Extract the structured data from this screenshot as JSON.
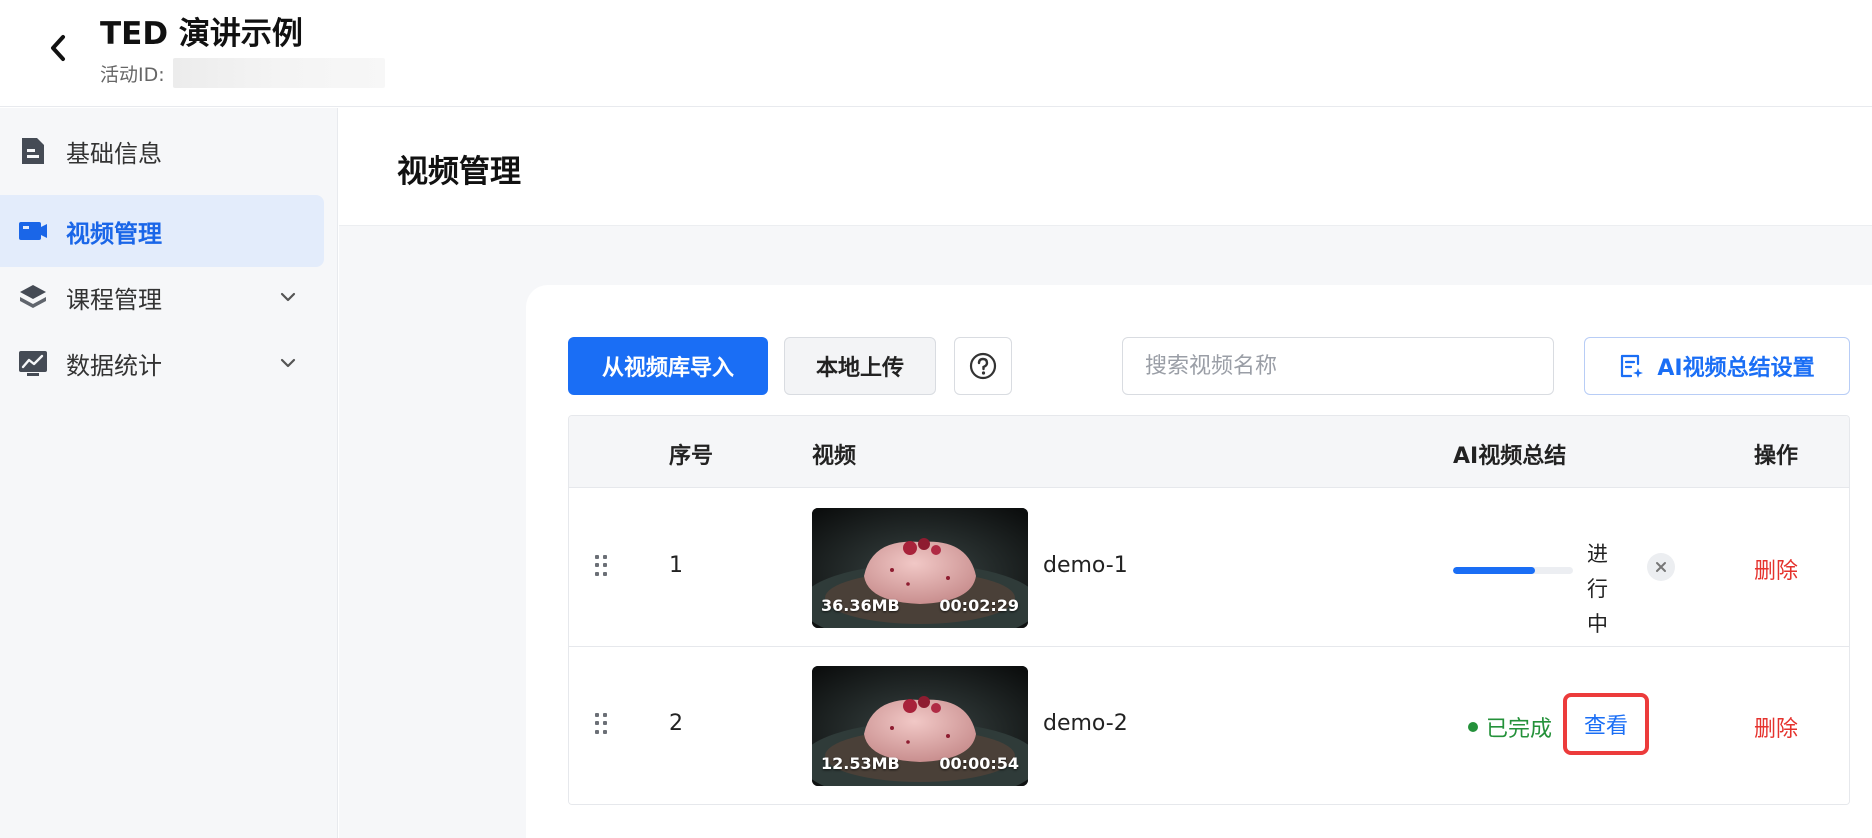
{
  "header": {
    "title": "TED 演讲示例",
    "activity_id_label": "活动ID:"
  },
  "sidebar": {
    "items": [
      {
        "label": "基础信息",
        "icon": "document-icon",
        "active": false
      },
      {
        "label": "视频管理",
        "icon": "video-icon",
        "active": true
      },
      {
        "label": "课程管理",
        "icon": "layers-icon",
        "active": false,
        "expandable": true
      },
      {
        "label": "数据统计",
        "icon": "chart-icon",
        "active": false,
        "expandable": true
      }
    ]
  },
  "main": {
    "page_title": "视频管理",
    "toolbar": {
      "import_label": "从视频库导入",
      "upload_label": "本地上传",
      "help_icon": "question-icon",
      "search_placeholder": "搜索视频名称",
      "ai_settings_label": "AI视频总结设置"
    },
    "table": {
      "columns": [
        "序号",
        "视频",
        "AI视频总结",
        "操作"
      ],
      "rows": [
        {
          "seq": "1",
          "name": "demo-1",
          "size": "36.36MB",
          "duration": "00:02:29",
          "ai_status": "in_progress",
          "progress": 0.68,
          "progress_text": "进行中",
          "action": "删除"
        },
        {
          "seq": "2",
          "name": "demo-2",
          "size": "12.53MB",
          "duration": "00:00:54",
          "ai_status": "done",
          "status_text": "已完成",
          "view_label": "查看",
          "action": "删除"
        }
      ]
    }
  },
  "colors": {
    "primary": "#1a6ef5",
    "active_nav_bg": "#e3ecfb",
    "success": "#24913a",
    "danger": "#e5322d",
    "highlight_border": "#ec3b3b"
  }
}
